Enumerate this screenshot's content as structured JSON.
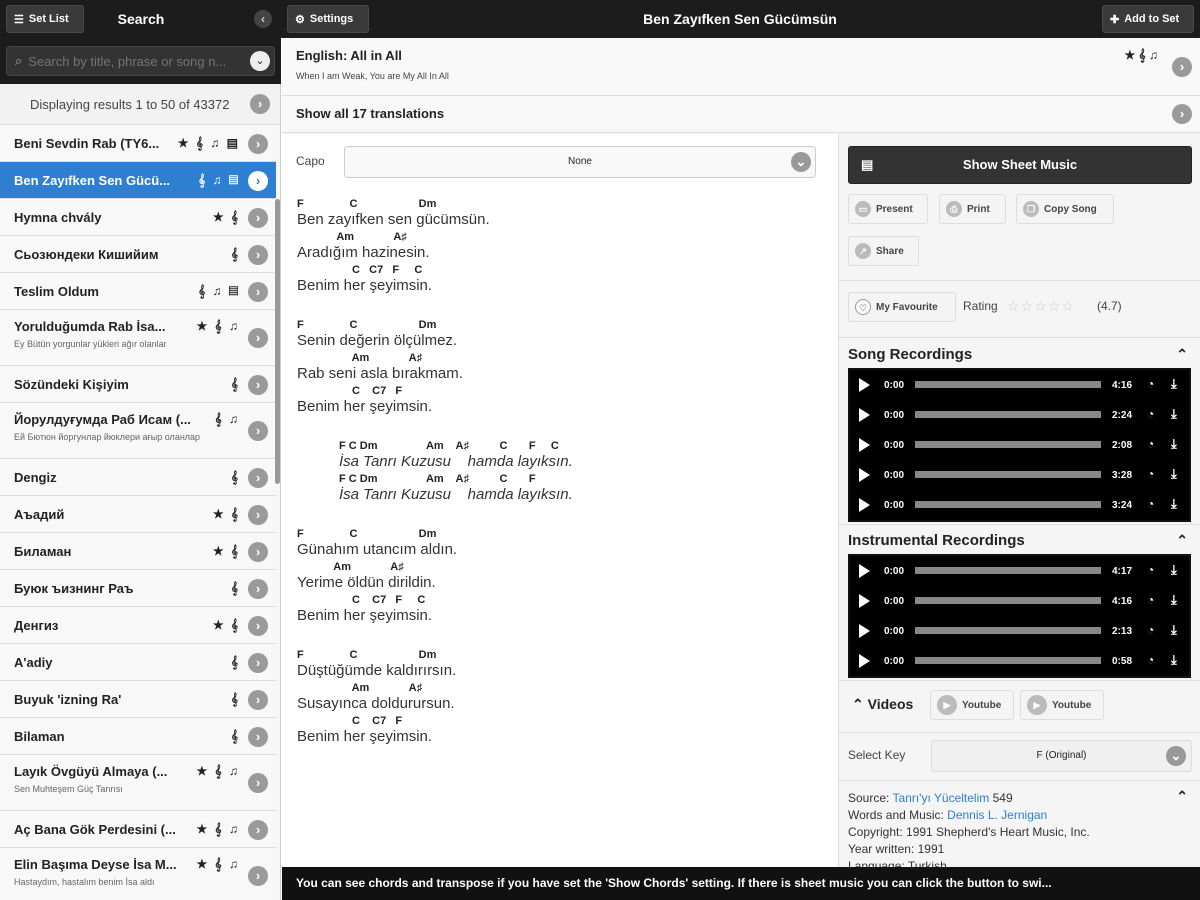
{
  "topbar": {
    "setlist_label": "Set List",
    "search_title": "Search",
    "settings_label": "Settings",
    "song_title": "Ben Zayıfken Sen Gücümsün",
    "add_label": "Add to Set"
  },
  "search": {
    "placeholder": "Search by title, phrase or song n..."
  },
  "results": {
    "header": "Displaying results 1 to 50 of 43372"
  },
  "songs": [
    {
      "title": "Beni Sevdin Rab (TY6...",
      "icons": "★ 𝄞 ♫ ▤",
      "sub": ""
    },
    {
      "title": "Ben Zayıfken Sen Gücü...",
      "icons": "𝄞 ♫ ▤",
      "sub": "",
      "active": true
    },
    {
      "title": "Hymna chvály",
      "icons": "★ 𝄞",
      "sub": ""
    },
    {
      "title": "Сьозюндеки Кишийим",
      "icons": "𝄞",
      "sub": ""
    },
    {
      "title": "Teslim Oldum",
      "icons": "𝄞 ♫ ▤",
      "sub": ""
    },
    {
      "title": "Yorulduğumda Rab İsa...",
      "icons": "★ 𝄞 ♫",
      "sub": "Ey Bütün yorgunlar yükleri ağır olanlar"
    },
    {
      "title": "Sözündeki Kişiyim",
      "icons": "𝄞",
      "sub": ""
    },
    {
      "title": "Йорулдуғумда Раб Исам (...",
      "icons": "𝄞 ♫",
      "sub": "Ей Бютюн йоргунлар йюклери ағыр оланлар"
    },
    {
      "title": "Dengiz",
      "icons": "𝄞",
      "sub": ""
    },
    {
      "title": "Аъадий",
      "icons": "★ 𝄞",
      "sub": ""
    },
    {
      "title": "Биламан",
      "icons": "★ 𝄞",
      "sub": ""
    },
    {
      "title": "Буюк ъизнинг Раъ",
      "icons": "𝄞",
      "sub": ""
    },
    {
      "title": "Денгиз",
      "icons": "★ 𝄞",
      "sub": ""
    },
    {
      "title": "A'adiy",
      "icons": "𝄞",
      "sub": ""
    },
    {
      "title": "Buyuk 'izning Ra'",
      "icons": "𝄞",
      "sub": ""
    },
    {
      "title": "Bilaman",
      "icons": "𝄞",
      "sub": ""
    },
    {
      "title": "Layık Övgüyü Almaya (...",
      "icons": "★ 𝄞 ♫",
      "sub": "Sen Muhteşem Güç Tanrısı"
    },
    {
      "title": "Aç Bana Gök Perdesini (...",
      "icons": "★ 𝄞 ♫",
      "sub": ""
    },
    {
      "title": "Elin Başıma Deyse İsa M...",
      "icons": "★ 𝄞 ♫",
      "sub": "Hastaydım, hastalım benim İsa aldı"
    }
  ],
  "translation": {
    "language": "English: All in All",
    "subtitle": "When I am Weak, You are My All In All",
    "icons": "★ 𝄞 ♫",
    "show_all": "Show all 17 translations"
  },
  "capo": {
    "label": "Capo",
    "value": "None"
  },
  "lyrics": [
    {
      "indent": false,
      "lines": [
        {
          "c": "F               C                    Dm",
          "l": "Ben zayıfken sen gücümsün.",
          "it": false
        },
        {
          "c": "             Am             A♯",
          "l": "Aradığım hazinesin.",
          "it": false
        },
        {
          "c": "                  C   C7   F     C",
          "l": "Benim her şeyimsin.",
          "it": false
        }
      ]
    },
    {
      "indent": false,
      "lines": [
        {
          "c": "F               C                    Dm",
          "l": "Senin değerin ölçülmez.",
          "it": false
        },
        {
          "c": "                  Am             A♯",
          "l": "Rab seni asla bırakmam.",
          "it": false
        },
        {
          "c": "                  C    C7   F",
          "l": "Benim her şeyimsin.",
          "it": false
        }
      ]
    },
    {
      "indent": true,
      "lines": [
        {
          "c": "F C Dm                Am    A♯          C       F     C",
          "l": "İsa Tanrı Kuzusu    hamda layıksın.",
          "it": true
        },
        {
          "c": "F C Dm                Am    A♯          C       F",
          "l": "İsa Tanrı Kuzusu    hamda layıksın.",
          "it": true
        }
      ]
    },
    {
      "indent": false,
      "lines": [
        {
          "c": "F               C                    Dm",
          "l": "Günahım utancım aldın.",
          "it": false
        },
        {
          "c": "            Am             A♯",
          "l": "Yerime öldün dirildin.",
          "it": false
        },
        {
          "c": "                  C    C7   F     C",
          "l": "Benim her şeyimsin.",
          "it": false
        }
      ]
    },
    {
      "indent": false,
      "lines": [
        {
          "c": "F               C                    Dm",
          "l": "Düştüğümde kaldırırsın.",
          "it": false
        },
        {
          "c": "                  Am             A♯",
          "l": "Susayınca doldurursun.",
          "it": false
        },
        {
          "c": "                  C    C7   F",
          "l": "Benim her şeyimsin.",
          "it": false
        }
      ]
    }
  ],
  "right": {
    "sheet_label": "Show Sheet Music",
    "present": "Present",
    "print": "Print",
    "copy": "Copy Song",
    "share": "Share",
    "favourite": "My Favourite",
    "rating_label": "Rating",
    "rating_value": "(4.7)",
    "rating_stars": 4.7,
    "song_rec_title": "Song Recordings",
    "inst_rec_title": "Instrumental Recordings",
    "videos_title": "Videos",
    "youtube1": "Youtube",
    "youtube2": "Youtube",
    "select_key_label": "Select Key",
    "key_value": "F (Original)"
  },
  "song_recordings": [
    {
      "cur": "0:00",
      "dur": "4:16"
    },
    {
      "cur": "0:00",
      "dur": "2:24"
    },
    {
      "cur": "0:00",
      "dur": "2:08"
    },
    {
      "cur": "0:00",
      "dur": "3:28"
    },
    {
      "cur": "0:00",
      "dur": "3:24"
    }
  ],
  "inst_recordings": [
    {
      "cur": "0:00",
      "dur": "4:17"
    },
    {
      "cur": "0:00",
      "dur": "4:16"
    },
    {
      "cur": "0:00",
      "dur": "2:13"
    },
    {
      "cur": "0:00",
      "dur": "0:58"
    }
  ],
  "meta": {
    "source_label": "Source: ",
    "source_link": "Tanrı'yı Yüceltelim",
    "source_num": " 549",
    "words_label": "Words and Music: ",
    "words_link": "Dennis L. Jernigan",
    "copyright": "Copyright: 1991 Shepherd's Heart Music, Inc.",
    "year": "Year written: 1991",
    "language": "Language: Turkish"
  },
  "tooltip": "You can see chords and transpose if you have set the 'Show Chords' setting. If there is sheet music you can click the button to swi..."
}
